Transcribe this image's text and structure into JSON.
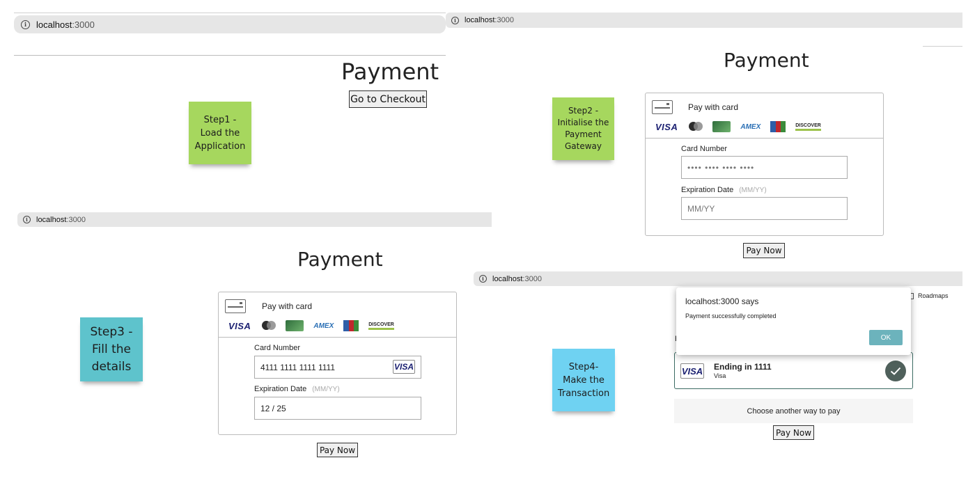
{
  "browser": {
    "host": "localhost",
    "port": ":3000"
  },
  "step1": {
    "page_title": "Payment",
    "checkout_button": "Go to Checkout",
    "note": "Step1 -\nLoad the\nApplication"
  },
  "step2": {
    "page_title": "Payment",
    "note": "Step2 -\nInitialise the\nPayment\nGateway",
    "pay_with_card": "Pay with card",
    "card_number_label": "Card Number",
    "card_number_placeholder": "•••• •••• •••• ••••",
    "expiration_label": "Expiration Date",
    "expiration_hint": "(MM/YY)",
    "expiration_placeholder": "MM/YY",
    "pay_button": "Pay Now"
  },
  "step3": {
    "page_title": "Payment",
    "note": "Step3 -\nFill the\ndetails",
    "pay_with_card": "Pay with card",
    "card_number_label": "Card Number",
    "card_number_value": "4111 1111 1111 1111",
    "card_brand": "VISA",
    "expiration_label": "Expiration Date",
    "expiration_hint": "(MM/YY)",
    "expiration_value": "12 / 25",
    "pay_button": "Pay Now"
  },
  "step4": {
    "note": "Step4-\nMake the\nTransaction",
    "bookmark": "Roadmaps",
    "dialog_title": "localhost:3000 says",
    "dialog_message": "Payment successfully completed",
    "ok_button": "OK",
    "card_brand": "VISA",
    "card_ending": "Ending in 1111",
    "card_type": "Visa",
    "other_way": "Choose another way to pay",
    "pay_button": "Pay Now"
  },
  "logos": [
    "visa",
    "mastercard",
    "amex-green",
    "amex",
    "jcb",
    "discover"
  ],
  "logo_text": {
    "visa": "VISA",
    "amex": "AMEX",
    "discover": "DISCOVER"
  },
  "colors": {
    "note_green": "#a6d75e",
    "note_teal": "#5ec3cc",
    "note_blue": "#6fd2f2",
    "ok_button": "#6cb3bc",
    "check_circle": "#4f605b",
    "selected_border": "#3b6b63"
  }
}
